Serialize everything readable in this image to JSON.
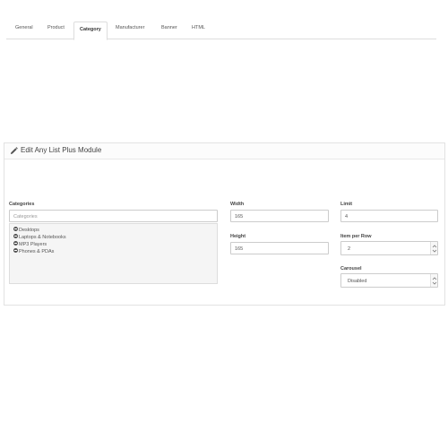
{
  "heading": {
    "title": "Edit Any List Plus Module",
    "icon": "pencil-icon"
  },
  "tabs": [
    {
      "label": "General"
    },
    {
      "label": "Product"
    },
    {
      "label": "Category",
      "active": true
    },
    {
      "label": "Manufacturer"
    },
    {
      "label": "Banner"
    },
    {
      "label": "HTML"
    }
  ],
  "categories": {
    "label": "Categories",
    "placeholder": "Categories",
    "items": [
      "Desktops",
      "Laptops & Notebooks",
      "MP3 Players",
      "Phones & PDAs"
    ]
  },
  "width": {
    "label": "Width",
    "value": "165"
  },
  "height": {
    "label": "Height",
    "value": "165"
  },
  "limit": {
    "label": "Limit",
    "value": "4"
  },
  "item_per_row": {
    "label": "Item per Row",
    "value": "2"
  },
  "carousel": {
    "label": "Carousel",
    "value": "Disabled"
  },
  "colors": {
    "border": "#cccccc",
    "panel_bg": "#ffffff",
    "tree_bg": "#f5f5f5"
  }
}
